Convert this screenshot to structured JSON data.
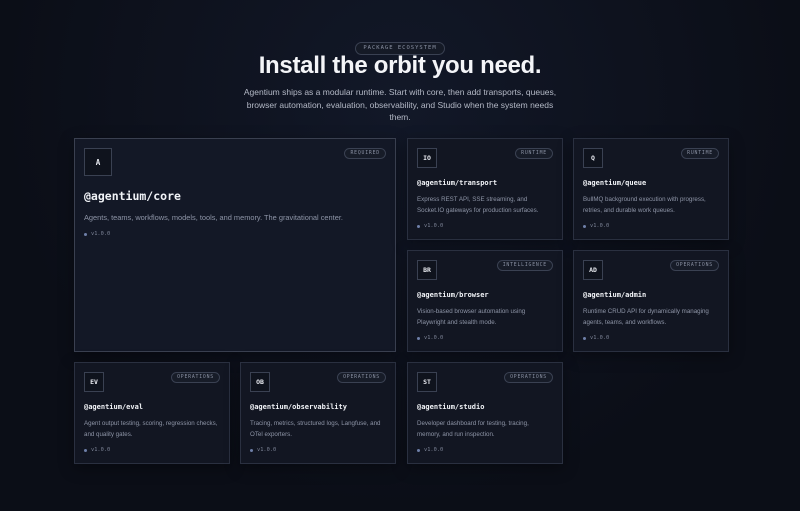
{
  "hero": {
    "eyebrow": "PACKAGE ECOSYSTEM",
    "title": "Install the orbit you need.",
    "subtitle": "Agentium ships as a modular runtime. Start with core, then add transports, queues, browser automation, evaluation, observability, and Studio when the system needs them."
  },
  "packages": [
    {
      "key": "core",
      "icon": "A",
      "badge": "REQUIRED",
      "name": "@agentium/core",
      "desc": "Agents, teams, workflows, models, tools, and memory. The gravitational center.",
      "version": "v1.0.0"
    },
    {
      "key": "transport",
      "icon": "IO",
      "badge": "RUNTIME",
      "name": "@agentium/transport",
      "desc": "Express REST API, SSE streaming, and Socket.IO gateways for production surfaces.",
      "version": "v1.0.0"
    },
    {
      "key": "queue",
      "icon": "Q",
      "badge": "RUNTIME",
      "name": "@agentium/queue",
      "desc": "BullMQ background execution with progress, retries, and durable work queues.",
      "version": "v1.0.0"
    },
    {
      "key": "browser",
      "icon": "BR",
      "badge": "INTELLIGENCE",
      "name": "@agentium/browser",
      "desc": "Vision-based browser automation using Playwright and stealth mode.",
      "version": "v1.0.0"
    },
    {
      "key": "admin",
      "icon": "AD",
      "badge": "OPERATIONS",
      "name": "@agentium/admin",
      "desc": "Runtime CRUD API for dynamically managing agents, teams, and workflows.",
      "version": "v1.0.0"
    },
    {
      "key": "eval",
      "icon": "EV",
      "badge": "OPERATIONS",
      "name": "@agentium/eval",
      "desc": "Agent output testing, scoring, regression checks, and quality gates.",
      "version": "v1.0.0"
    },
    {
      "key": "observability",
      "icon": "OB",
      "badge": "OPERATIONS",
      "name": "@agentium/observability",
      "desc": "Tracing, metrics, structured logs, Langfuse, and OTel exporters.",
      "version": "v1.0.0"
    },
    {
      "key": "studio",
      "icon": "ST",
      "badge": "OPERATIONS",
      "name": "@agentium/studio",
      "desc": "Developer dashboard for testing, tracing, memory, and run inspection.",
      "version": "v1.0.0"
    }
  ]
}
